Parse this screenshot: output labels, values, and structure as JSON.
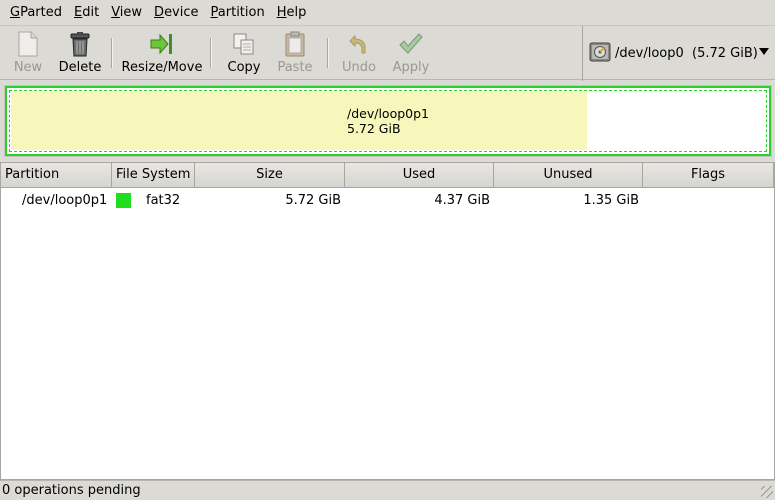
{
  "menu": [
    {
      "label": "GParted",
      "mnemonic": "G",
      "rest": "Parted"
    },
    {
      "label": "Edit",
      "mnemonic": "E",
      "rest": "dit"
    },
    {
      "label": "View",
      "mnemonic": "V",
      "rest": "iew"
    },
    {
      "label": "Device",
      "mnemonic": "D",
      "rest": "evice"
    },
    {
      "label": "Partition",
      "mnemonic": "P",
      "rest": "artition"
    },
    {
      "label": "Help",
      "mnemonic": "H",
      "rest": "elp"
    }
  ],
  "toolbar": {
    "new": "New",
    "delete": "Delete",
    "resize": "Resize/Move",
    "copy": "Copy",
    "paste": "Paste",
    "undo": "Undo",
    "apply": "Apply"
  },
  "device": {
    "name": "/dev/loop0",
    "size": "(5.72 GiB)"
  },
  "map": {
    "partition": "/dev/loop0p1",
    "size": "5.72 GiB",
    "used_fraction": 0.764
  },
  "table": {
    "columns": [
      "Partition",
      "File System",
      "Size",
      "Used",
      "Unused",
      "Flags"
    ],
    "rows": [
      {
        "partition": "/dev/loop0p1",
        "filesystem": "fat32",
        "size": "5.72 GiB",
        "used": "4.37 GiB",
        "unused": "1.35 GiB",
        "flags": ""
      }
    ]
  },
  "status": "0 operations pending",
  "colors": {
    "fat32": "#1ede1e",
    "used_area": "#f7f7bb",
    "partition_border": "#2bd12b"
  }
}
